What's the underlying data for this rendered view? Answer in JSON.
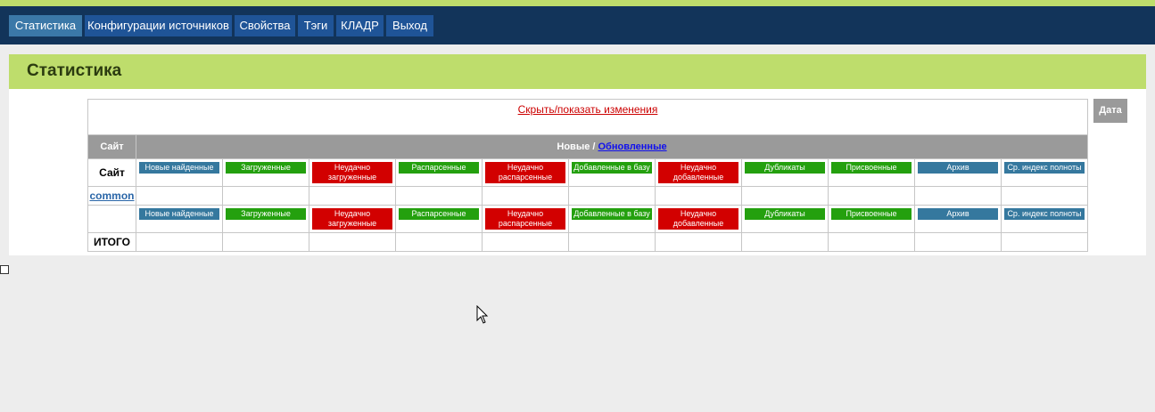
{
  "nav": {
    "items": [
      {
        "label": "Статистика",
        "active": true
      },
      {
        "label": "Конфигурации источников"
      },
      {
        "label": "Свойства"
      },
      {
        "label": "Тэги"
      },
      {
        "label": "КЛАДР"
      },
      {
        "label": "Выход"
      }
    ]
  },
  "page": {
    "title": "Статистика"
  },
  "stats": {
    "toggle_label": "Скрыть/показать изменения",
    "site_header": "Сайт",
    "new_label": "Новые",
    "separator": " / ",
    "updated_label": "Обновленные",
    "row_site_label": "Сайт",
    "site_link": "common",
    "total_label": "ИТОГО",
    "columns": [
      {
        "label": "Новые найденные",
        "color": "#35789e"
      },
      {
        "label": "Загруженные",
        "color": "#24a00e"
      },
      {
        "label": "Неудачно загруженные",
        "color": "#d20000"
      },
      {
        "label": "Распарсенные",
        "color": "#24a00e"
      },
      {
        "label": "Неудачно распарсенные",
        "color": "#d20000"
      },
      {
        "label": "Добавленные в базу",
        "color": "#24a00e"
      },
      {
        "label": "Неудачно добавленные",
        "color": "#d20000"
      },
      {
        "label": "Дубликаты",
        "color": "#24a00e"
      },
      {
        "label": "Присвоенные",
        "color": "#24a00e"
      },
      {
        "label": "Архив",
        "color": "#35789e"
      },
      {
        "label": "Ср. индекс полноты",
        "color": "#35789e"
      }
    ]
  },
  "date_button": "Дата"
}
